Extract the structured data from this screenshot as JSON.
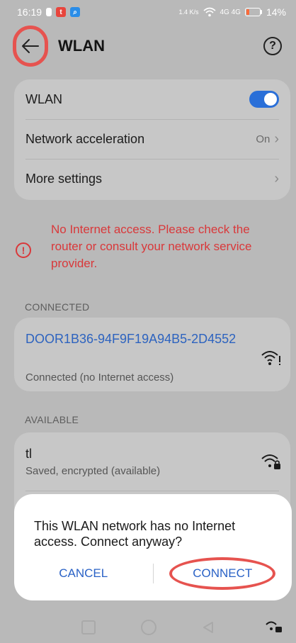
{
  "status_bar": {
    "time": "16:19",
    "speed": "1.4 K/s",
    "signal": "4G 4G",
    "battery": "14%",
    "badge_colors": [
      "#e8453c",
      "#2a8de8"
    ]
  },
  "header": {
    "title": "WLAN",
    "back_icon": "arrow-left-icon",
    "help_icon": "question-circle-icon",
    "help_glyph": "?"
  },
  "settings": {
    "wlan_label": "WLAN",
    "wlan_enabled": true,
    "acceleration_label": "Network acceleration",
    "acceleration_value": "On",
    "more_label": "More settings"
  },
  "warning": {
    "text": "No Internet access. Please check the router or consult your network service provider.",
    "icon_glyph": "!"
  },
  "connected": {
    "section_label": "CONNECTED",
    "network_name": "DOOR1B36-94F9F19A94B5-2D4552",
    "status": "Connected (no Internet access)"
  },
  "available": {
    "section_label": "AVAILABLE",
    "networks": [
      {
        "name": "tl",
        "status": "Saved, encrypted (available)"
      }
    ]
  },
  "dialog": {
    "message": "This WLAN network has no Internet access. Connect anyway?",
    "cancel_label": "CANCEL",
    "connect_label": "CONNECT"
  },
  "colors": {
    "accent_blue": "#2a6fd8",
    "warning_red": "#d9383a",
    "annotation_red": "#e6534f"
  }
}
